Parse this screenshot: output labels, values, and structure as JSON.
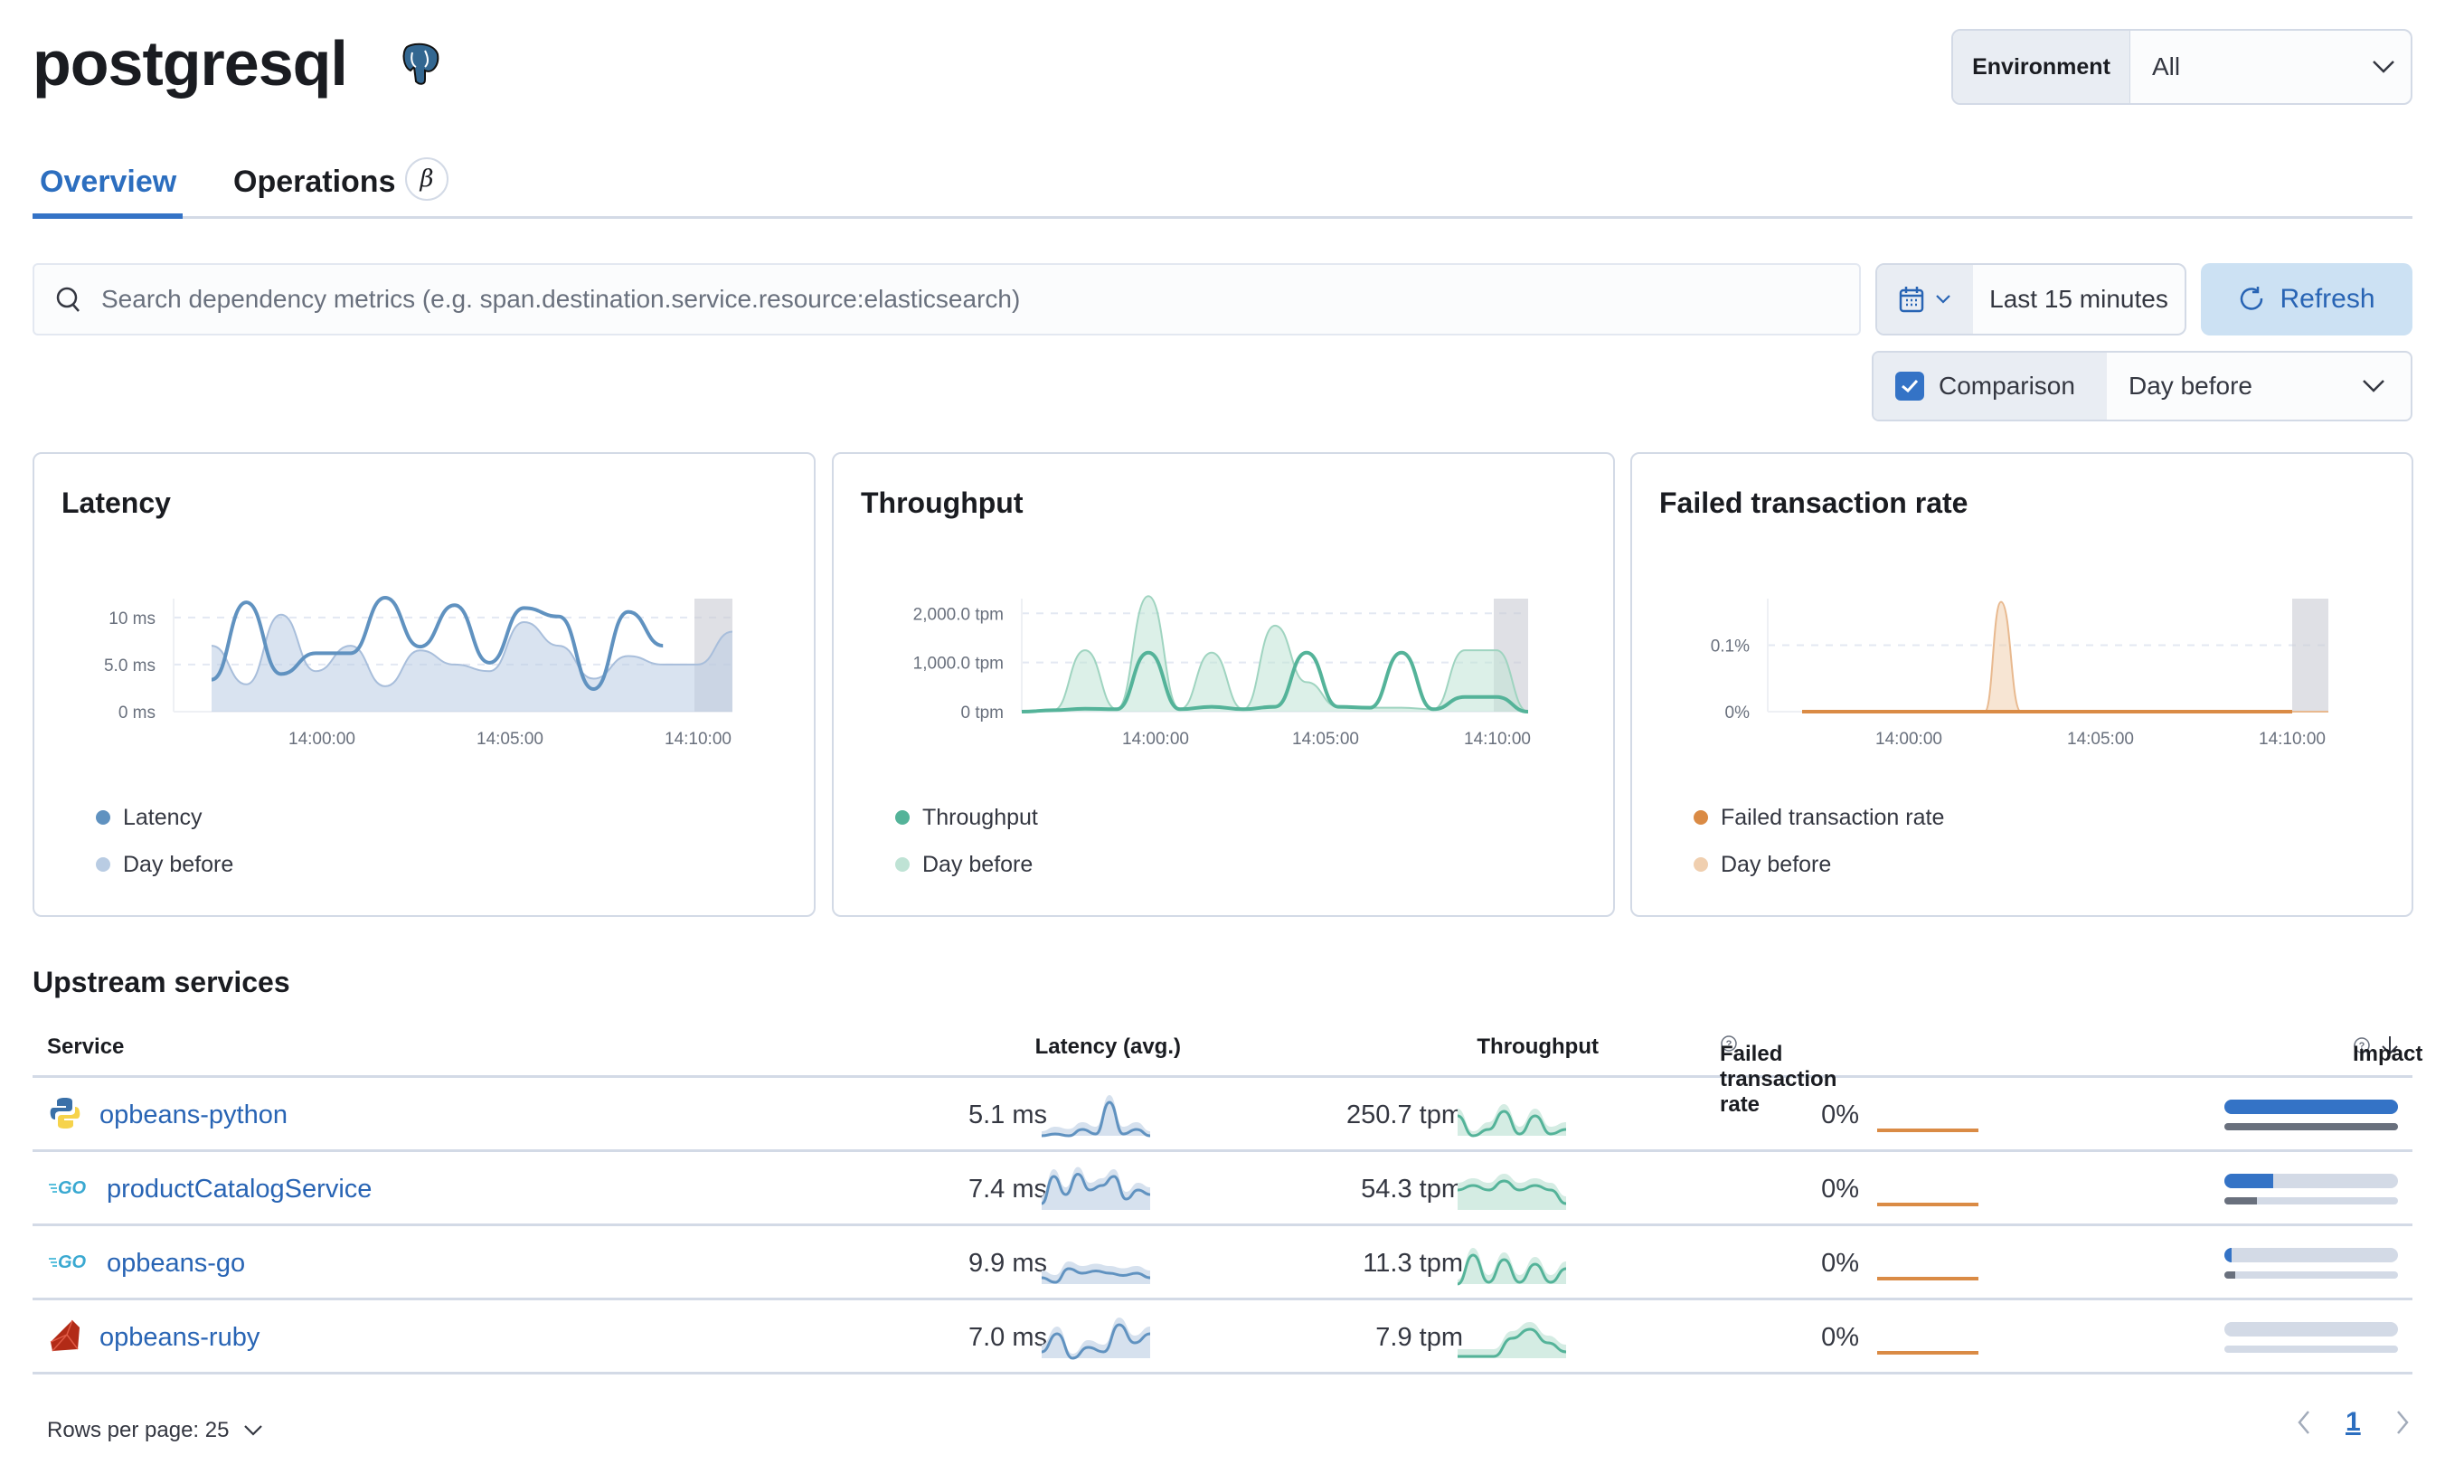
{
  "header": {
    "title": "postgresql",
    "icon": "postgresql-elephant-icon"
  },
  "environment": {
    "label": "Environment",
    "value": "All"
  },
  "tabs": [
    {
      "label": "Overview",
      "active": true
    },
    {
      "label": "Operations",
      "badge": "β"
    }
  ],
  "search": {
    "placeholder": "Search dependency metrics (e.g. span.destination.service.resource:elasticsearch)"
  },
  "datepicker": {
    "value": "Last 15 minutes"
  },
  "refresh": {
    "label": "Refresh"
  },
  "comparison": {
    "label": "Comparison",
    "checked": true,
    "value": "Day before"
  },
  "colors": {
    "accent": "#3473c6",
    "latency": "#6092c0",
    "throughput": "#54b399",
    "failed": "#da8b45"
  },
  "chart_data": [
    {
      "type": "line",
      "title": "Latency",
      "x": [
        "13:56:30",
        "13:57:30",
        "13:58:30",
        "13:59:30",
        "14:00:30",
        "14:01:30",
        "14:02:30",
        "14:03:30",
        "14:04:30",
        "14:05:30",
        "14:06:30",
        "14:07:30",
        "14:08:30",
        "14:09:30",
        "14:10:00",
        "14:11:00"
      ],
      "xticks": [
        "14:00:00",
        "14:05:00",
        "14:10:00"
      ],
      "yticks": [
        "0 ms",
        "5.0 ms",
        "10 ms"
      ],
      "ylim": [
        0,
        12
      ],
      "series": [
        {
          "name": "Latency",
          "values": [
            3.4,
            11.6,
            4.0,
            6.2,
            6.2,
            12.1,
            6.9,
            11.3,
            5.2,
            11.0,
            10.1,
            2.4,
            10.6,
            7.0,
            null,
            null
          ]
        },
        {
          "name": "Day before",
          "values": [
            7.0,
            2.9,
            10.3,
            4.3,
            7.0,
            2.7,
            6.5,
            5.0,
            4.3,
            9.5,
            7.0,
            3.5,
            5.9,
            5.0,
            5.0,
            8.5
          ]
        }
      ],
      "legend": [
        "Latency",
        "Day before"
      ]
    },
    {
      "type": "line",
      "title": "Throughput",
      "x": [
        "13:55:30",
        "13:56:30",
        "13:57:30",
        "13:58:30",
        "13:59:30",
        "14:00:30",
        "14:01:30",
        "14:02:30",
        "14:03:30",
        "14:04:30",
        "14:05:30",
        "14:06:30",
        "14:07:30",
        "14:08:30",
        "14:09:30",
        "14:10:00",
        "14:11:00"
      ],
      "xticks": [
        "14:00:00",
        "14:05:00",
        "14:10:00"
      ],
      "yticks": [
        "0 tpm",
        "1,000.0 tpm",
        "2,000.0 tpm"
      ],
      "ylim": [
        0,
        2300
      ],
      "series": [
        {
          "name": "Throughput",
          "values": [
            0,
            30,
            60,
            50,
            1200,
            50,
            100,
            50,
            100,
            1200,
            100,
            80,
            1200,
            50,
            300,
            300,
            0
          ]
        },
        {
          "name": "Day before",
          "values": [
            0,
            30,
            1250,
            50,
            2350,
            50,
            1200,
            50,
            1750,
            600,
            100,
            80,
            80,
            50,
            1250,
            1250,
            0
          ]
        }
      ],
      "legend": [
        "Throughput",
        "Day before"
      ]
    },
    {
      "type": "line",
      "title": "Failed transaction rate",
      "x": [
        "13:56:30",
        "13:58:30",
        "13:59:30",
        "14:01:00",
        "14:01:45",
        "14:02:30",
        "14:04:30",
        "14:07:30",
        "14:10:00",
        "14:11:00"
      ],
      "xticks": [
        "14:00:00",
        "14:05:00",
        "14:10:00"
      ],
      "yticks": [
        "0%",
        "0.1%"
      ],
      "ylim": [
        0,
        0.17
      ],
      "series": [
        {
          "name": "Failed transaction rate",
          "values": [
            0,
            0,
            0,
            0,
            0,
            0,
            0,
            0,
            0,
            null
          ]
        },
        {
          "name": "Day before",
          "values": [
            0,
            0,
            0,
            0,
            0.165,
            0,
            0,
            0,
            0,
            0
          ]
        }
      ],
      "legend": [
        "Failed transaction rate",
        "Day before"
      ]
    }
  ],
  "upstream": {
    "title": "Upstream services",
    "columns": {
      "service": "Service",
      "latency": "Latency (avg.)",
      "throughput": "Throughput",
      "failed": "Failed transaction rate",
      "impact": "Impact"
    },
    "rows": [
      {
        "service": "opbeans-python",
        "icon": "python-icon",
        "latency": "5.1 ms",
        "throughput": "250.7 tpm",
        "failed": "0%",
        "impact": 1.0,
        "impact_prev": 1.0
      },
      {
        "service": "productCatalogService",
        "icon": "go-icon",
        "latency": "7.4 ms",
        "throughput": "54.3 tpm",
        "failed": "0%",
        "impact": 0.28,
        "impact_prev": 0.19
      },
      {
        "service": "opbeans-go",
        "icon": "go-icon",
        "latency": "9.9 ms",
        "throughput": "11.3 tpm",
        "failed": "0%",
        "impact": 0.04,
        "impact_prev": 0.06
      },
      {
        "service": "opbeans-ruby",
        "icon": "ruby-icon",
        "latency": "7.0 ms",
        "throughput": "7.9 tpm",
        "failed": "0%",
        "impact": 0,
        "impact_prev": 0
      }
    ]
  },
  "pagination": {
    "rows_per_page": "Rows per page: 25",
    "current_page": "1"
  }
}
